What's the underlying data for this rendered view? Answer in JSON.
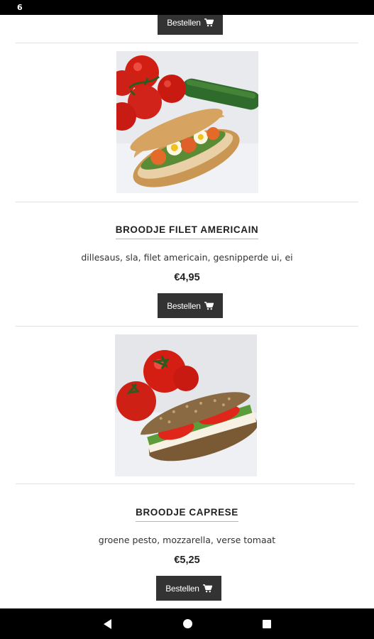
{
  "status_bar": {
    "time": "6"
  },
  "products": [
    {
      "name": "BROODJE FILET AMERICAIN",
      "description": "dillesaus, sla, filet americain, gesnipperde ui, ei",
      "price": "€4,95",
      "order_label": "Bestellen"
    },
    {
      "name": "BROODJE CAPRESE",
      "description": "groene pesto, mozzarella, verse tomaat",
      "price": "€5,25",
      "order_label": "Bestellen"
    }
  ],
  "previous_item": {
    "order_label": "Bestellen"
  },
  "nav": {
    "back_icon": "back-icon",
    "home_icon": "home-icon",
    "recents_icon": "recents-icon"
  }
}
